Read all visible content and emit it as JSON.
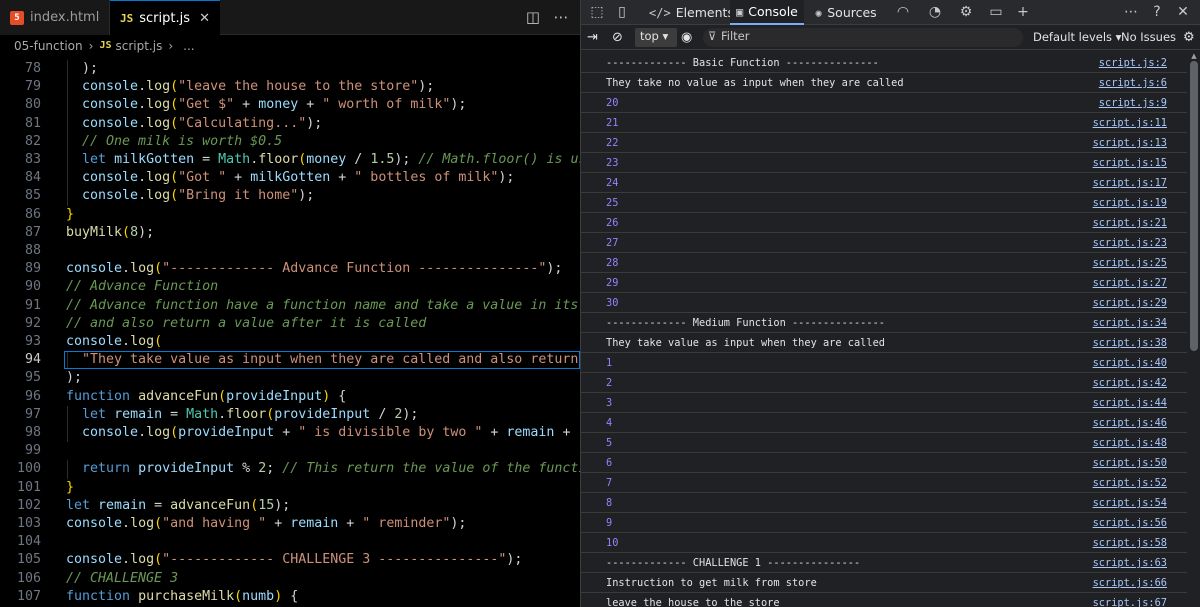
{
  "editor": {
    "tabs": [
      {
        "icon": "5",
        "label": "index.html"
      },
      {
        "icon": "JS",
        "label": "script.js",
        "close": "✕"
      }
    ],
    "breadcrumb": {
      "folder": "05-function",
      "file_icon": "JS",
      "file": "script.js",
      "trailing": "..."
    },
    "lines": [
      {
        "n": 78,
        "tokens": [
          [
            "  ",
            ""
          ],
          [
            ");",
            ""
          ]
        ]
      },
      {
        "n": 79,
        "tokens": [
          [
            "  ",
            ""
          ],
          [
            "console",
            "var"
          ],
          [
            ".",
            ""
          ],
          [
            "log",
            "fn"
          ],
          [
            "(",
            "br"
          ],
          [
            "\"leave the house to the store\"",
            "str"
          ],
          [
            ");",
            ""
          ]
        ]
      },
      {
        "n": 80,
        "tokens": [
          [
            "  ",
            ""
          ],
          [
            "console",
            "var"
          ],
          [
            ".",
            ""
          ],
          [
            "log",
            "fn"
          ],
          [
            "(",
            "br"
          ],
          [
            "\"Get $\"",
            "str"
          ],
          [
            " + ",
            ""
          ],
          [
            "money",
            "var"
          ],
          [
            " + ",
            ""
          ],
          [
            "\" worth of milk\"",
            "str"
          ],
          [
            ");",
            ""
          ]
        ]
      },
      {
        "n": 81,
        "tokens": [
          [
            "  ",
            ""
          ],
          [
            "console",
            "var"
          ],
          [
            ".",
            ""
          ],
          [
            "log",
            "fn"
          ],
          [
            "(",
            "br"
          ],
          [
            "\"Calculating...\"",
            "str"
          ],
          [
            ");",
            ""
          ]
        ]
      },
      {
        "n": 82,
        "tokens": [
          [
            "  ",
            ""
          ],
          [
            "// One milk is worth $0.5",
            "cmt"
          ]
        ]
      },
      {
        "n": 83,
        "tokens": [
          [
            "  ",
            ""
          ],
          [
            "let",
            "kw"
          ],
          [
            " ",
            ""
          ],
          [
            "milkGotten",
            "var"
          ],
          [
            " = ",
            ""
          ],
          [
            "Math",
            "obj"
          ],
          [
            ".",
            ""
          ],
          [
            "floor",
            "fn"
          ],
          [
            "(",
            "br"
          ],
          [
            "money",
            "var"
          ],
          [
            " / ",
            ""
          ],
          [
            "1.5",
            "num"
          ],
          [
            ");",
            ""
          ],
          [
            " // Math.floor() is used to",
            "cmt"
          ]
        ]
      },
      {
        "n": 84,
        "tokens": [
          [
            "  ",
            ""
          ],
          [
            "console",
            "var"
          ],
          [
            ".",
            ""
          ],
          [
            "log",
            "fn"
          ],
          [
            "(",
            "br"
          ],
          [
            "\"Got \"",
            "str"
          ],
          [
            " + ",
            ""
          ],
          [
            "milkGotten",
            "var"
          ],
          [
            " + ",
            ""
          ],
          [
            "\" bottles of milk\"",
            "str"
          ],
          [
            ");",
            ""
          ]
        ]
      },
      {
        "n": 85,
        "tokens": [
          [
            "  ",
            ""
          ],
          [
            "console",
            "var"
          ],
          [
            ".",
            ""
          ],
          [
            "log",
            "fn"
          ],
          [
            "(",
            "br"
          ],
          [
            "\"Bring it home\"",
            "str"
          ],
          [
            ");",
            ""
          ]
        ]
      },
      {
        "n": 86,
        "tokens": [
          [
            "}",
            "br"
          ]
        ]
      },
      {
        "n": 87,
        "tokens": [
          [
            "buyMilk",
            "fn"
          ],
          [
            "(",
            "br"
          ],
          [
            "8",
            "num"
          ],
          [
            ");",
            ""
          ]
        ]
      },
      {
        "n": 88,
        "tokens": []
      },
      {
        "n": 89,
        "tokens": [
          [
            "console",
            "var"
          ],
          [
            ".",
            ""
          ],
          [
            "log",
            "fn"
          ],
          [
            "(",
            "br"
          ],
          [
            "\"------------- Advance Function ---------------\"",
            "str"
          ],
          [
            ");",
            ""
          ]
        ]
      },
      {
        "n": 90,
        "tokens": [
          [
            "// Advance Function",
            "cmt"
          ]
        ]
      },
      {
        "n": 91,
        "tokens": [
          [
            "// Advance function have a function name and take a value in its para",
            "cmt"
          ]
        ]
      },
      {
        "n": 92,
        "tokens": [
          [
            "// and also return a value after it is called",
            "cmt"
          ]
        ]
      },
      {
        "n": 93,
        "tokens": [
          [
            "console",
            "var"
          ],
          [
            ".",
            ""
          ],
          [
            "log",
            "fn"
          ],
          [
            "(",
            "br"
          ]
        ]
      },
      {
        "n": 94,
        "tokens": [
          [
            "  ",
            ""
          ],
          [
            "\"They take value as input when they are called and also return a va",
            "str"
          ]
        ],
        "active": true
      },
      {
        "n": 95,
        "tokens": [
          [
            ");",
            ""
          ]
        ]
      },
      {
        "n": 96,
        "tokens": [
          [
            "function",
            "kw"
          ],
          [
            " ",
            ""
          ],
          [
            "advanceFun",
            "fn"
          ],
          [
            "(",
            "br"
          ],
          [
            "provideInput",
            "var"
          ],
          [
            ")",
            "br"
          ],
          [
            " {",
            ""
          ]
        ]
      },
      {
        "n": 97,
        "tokens": [
          [
            "  ",
            ""
          ],
          [
            "let",
            "kw"
          ],
          [
            " ",
            ""
          ],
          [
            "remain",
            "var"
          ],
          [
            " = ",
            ""
          ],
          [
            "Math",
            "obj"
          ],
          [
            ".",
            ""
          ],
          [
            "floor",
            "fn"
          ],
          [
            "(",
            "br"
          ],
          [
            "provideInput",
            "var"
          ],
          [
            " / ",
            ""
          ],
          [
            "2",
            "num"
          ],
          [
            ");",
            ""
          ]
        ]
      },
      {
        "n": 98,
        "tokens": [
          [
            "  ",
            ""
          ],
          [
            "console",
            "var"
          ],
          [
            ".",
            ""
          ],
          [
            "log",
            "fn"
          ],
          [
            "(",
            "br"
          ],
          [
            "provideInput",
            "var"
          ],
          [
            " + ",
            ""
          ],
          [
            "\" is divisible by two \"",
            "str"
          ],
          [
            " + ",
            ""
          ],
          [
            "remain",
            "var"
          ],
          [
            " + ",
            ""
          ],
          [
            "\" tim",
            "str"
          ]
        ]
      },
      {
        "n": 99,
        "tokens": []
      },
      {
        "n": 100,
        "tokens": [
          [
            "  ",
            ""
          ],
          [
            "return",
            "kw"
          ],
          [
            " ",
            ""
          ],
          [
            "provideInput",
            "var"
          ],
          [
            " % ",
            ""
          ],
          [
            "2",
            "num"
          ],
          [
            ";",
            ""
          ],
          [
            " // This return the value of the function,",
            "cmt"
          ]
        ]
      },
      {
        "n": 101,
        "tokens": [
          [
            "}",
            "br"
          ]
        ]
      },
      {
        "n": 102,
        "tokens": [
          [
            "let",
            "kw"
          ],
          [
            " ",
            ""
          ],
          [
            "remain",
            "var"
          ],
          [
            " = ",
            ""
          ],
          [
            "advanceFun",
            "fn"
          ],
          [
            "(",
            "br"
          ],
          [
            "15",
            "num"
          ],
          [
            ");",
            ""
          ]
        ]
      },
      {
        "n": 103,
        "tokens": [
          [
            "console",
            "var"
          ],
          [
            ".",
            ""
          ],
          [
            "log",
            "fn"
          ],
          [
            "(",
            "br"
          ],
          [
            "\"and having \"",
            "str"
          ],
          [
            " + ",
            ""
          ],
          [
            "remain",
            "var"
          ],
          [
            " + ",
            ""
          ],
          [
            "\" reminder\"",
            "str"
          ],
          [
            ");",
            ""
          ]
        ]
      },
      {
        "n": 104,
        "tokens": []
      },
      {
        "n": 105,
        "tokens": [
          [
            "console",
            "var"
          ],
          [
            ".",
            ""
          ],
          [
            "log",
            "fn"
          ],
          [
            "(",
            "br"
          ],
          [
            "\"------------- CHALLENGE 3 ---------------\"",
            "str"
          ],
          [
            ");",
            ""
          ]
        ]
      },
      {
        "n": 106,
        "tokens": [
          [
            "// CHALLENGE 3",
            "cmt"
          ]
        ]
      },
      {
        "n": 107,
        "tokens": [
          [
            "function",
            "kw"
          ],
          [
            " ",
            ""
          ],
          [
            "purchaseMilk",
            "fn"
          ],
          [
            "(",
            "br"
          ],
          [
            "numb",
            "var"
          ],
          [
            ")",
            "br"
          ],
          [
            " {",
            ""
          ]
        ]
      }
    ]
  },
  "devtools": {
    "tabs": [
      {
        "icon": "</>",
        "label": "Elements"
      },
      {
        "icon": "▣",
        "label": "Console",
        "active": true
      },
      {
        "icon": "✺",
        "label": "Sources"
      }
    ],
    "toolbar": {
      "context": "top ▾",
      "filter_placeholder": "Filter",
      "levels": "Default levels ▾",
      "issues": "No Issues"
    },
    "messages": [
      {
        "text": "------------- Basic Function ---------------",
        "src": "script.js:2",
        "num": false
      },
      {
        "text": "They take no value as input when they are called",
        "src": "script.js:6",
        "num": false
      },
      {
        "text": "20",
        "src": "script.js:9",
        "num": true
      },
      {
        "text": "21",
        "src": "script.js:11",
        "num": true
      },
      {
        "text": "22",
        "src": "script.js:13",
        "num": true
      },
      {
        "text": "23",
        "src": "script.js:15",
        "num": true
      },
      {
        "text": "24",
        "src": "script.js:17",
        "num": true
      },
      {
        "text": "25",
        "src": "script.js:19",
        "num": true
      },
      {
        "text": "26",
        "src": "script.js:21",
        "num": true
      },
      {
        "text": "27",
        "src": "script.js:23",
        "num": true
      },
      {
        "text": "28",
        "src": "script.js:25",
        "num": true
      },
      {
        "text": "29",
        "src": "script.js:27",
        "num": true
      },
      {
        "text": "30",
        "src": "script.js:29",
        "num": true
      },
      {
        "text": "------------- Medium Function ---------------",
        "src": "script.js:34",
        "num": false
      },
      {
        "text": "They take value as input when they are called",
        "src": "script.js:38",
        "num": false
      },
      {
        "text": "1",
        "src": "script.js:40",
        "num": true
      },
      {
        "text": "2",
        "src": "script.js:42",
        "num": true
      },
      {
        "text": "3",
        "src": "script.js:44",
        "num": true
      },
      {
        "text": "4",
        "src": "script.js:46",
        "num": true
      },
      {
        "text": "5",
        "src": "script.js:48",
        "num": true
      },
      {
        "text": "6",
        "src": "script.js:50",
        "num": true
      },
      {
        "text": "7",
        "src": "script.js:52",
        "num": true
      },
      {
        "text": "8",
        "src": "script.js:54",
        "num": true
      },
      {
        "text": "9",
        "src": "script.js:56",
        "num": true
      },
      {
        "text": "10",
        "src": "script.js:58",
        "num": true
      },
      {
        "text": "------------- CHALLENGE 1 ---------------",
        "src": "script.js:63",
        "num": false
      },
      {
        "text": "Instruction to get milk from store",
        "src": "script.js:66",
        "num": false
      },
      {
        "text": "leave the house to the store",
        "src": "script.js:67",
        "num": false
      }
    ]
  }
}
